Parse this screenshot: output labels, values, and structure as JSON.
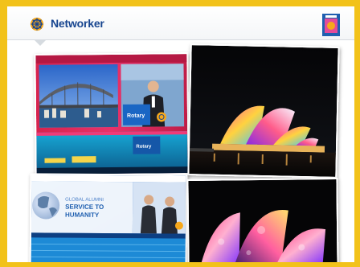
{
  "header": {
    "brand": "Networker",
    "logo_icon": "rotary-wheel-icon",
    "badge_icon": "magazine-badge-icon"
  },
  "photos": {
    "convention_stage": {
      "podium_label": "Rotary",
      "screen_label": "Rotary"
    },
    "opera_house_night": {},
    "alumni_screen": {
      "line1": "GLOBAL ALUMNI",
      "line2": "SERVICE TO",
      "line3": "HUMANITY"
    },
    "opera_house_closeup": {}
  },
  "colors": {
    "frame": "#f2c21a",
    "brand_blue": "#17458f",
    "rotary_gold": "#f7a81b"
  }
}
